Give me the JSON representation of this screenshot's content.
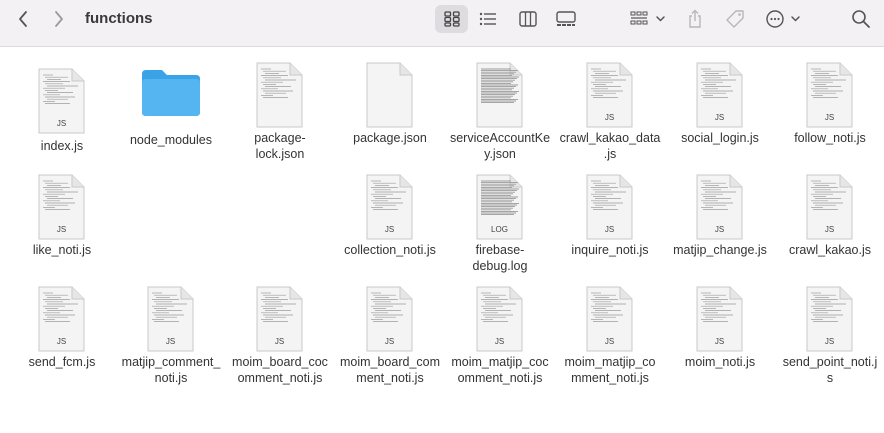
{
  "toolbar": {
    "title": "functions",
    "icons": [
      "chevron-left-icon",
      "chevron-right-icon",
      "grid-view-icon",
      "list-view-icon",
      "column-view-icon",
      "gallery-view-icon",
      "group-icon",
      "share-icon",
      "tag-icon",
      "more-icon",
      "search-icon"
    ]
  },
  "files": [
    {
      "name": "index.js",
      "kind": "js",
      "badge": "JS"
    },
    {
      "name": "node_modules",
      "kind": "folder",
      "badge": ""
    },
    {
      "name": "package-\nlock.json",
      "kind": "doc",
      "badge": ""
    },
    {
      "name": "package.json",
      "kind": "blank",
      "badge": ""
    },
    {
      "name": "serviceAccountKe\ny.json",
      "kind": "dense",
      "badge": ""
    },
    {
      "name": "crawl_kakao_data\n.js",
      "kind": "js",
      "badge": "JS"
    },
    {
      "name": "social_login.js",
      "kind": "js",
      "badge": "JS"
    },
    {
      "name": "follow_noti.js",
      "kind": "js",
      "badge": "JS"
    },
    {
      "name": "like_noti.js",
      "kind": "js",
      "badge": "JS"
    },
    {
      "name": "collection_noti.js",
      "kind": "js",
      "badge": "JS"
    },
    {
      "name": "firebase-\ndebug.log",
      "kind": "dense",
      "badge": "LOG"
    },
    {
      "name": "inquire_noti.js",
      "kind": "js",
      "badge": "JS"
    },
    {
      "name": "matjip_change.js",
      "kind": "js",
      "badge": "JS"
    },
    {
      "name": "crawl_kakao.js",
      "kind": "js",
      "badge": "JS"
    },
    {
      "name": "send_fcm.js",
      "kind": "js",
      "badge": "JS"
    },
    {
      "name": "matjip_comment_\nnoti.js",
      "kind": "js",
      "badge": "JS"
    },
    {
      "name": "moim_board_coc\nomment_noti.js",
      "kind": "js",
      "badge": "JS"
    },
    {
      "name": "moim_board_com\nment_noti.js",
      "kind": "js",
      "badge": "JS"
    },
    {
      "name": "moim_matjip_coc\nomment_noti.js",
      "kind": "js",
      "badge": "JS"
    },
    {
      "name": "moim_matjip_co\nmment_noti.js",
      "kind": "js",
      "badge": "JS"
    },
    {
      "name": "moim_noti.js",
      "kind": "js",
      "badge": "JS"
    },
    {
      "name": "send_point_noti.j\ns",
      "kind": "js",
      "badge": "JS"
    }
  ],
  "colors": {
    "folder": "#54b5f0",
    "folderTop": "#3aa3e8"
  }
}
